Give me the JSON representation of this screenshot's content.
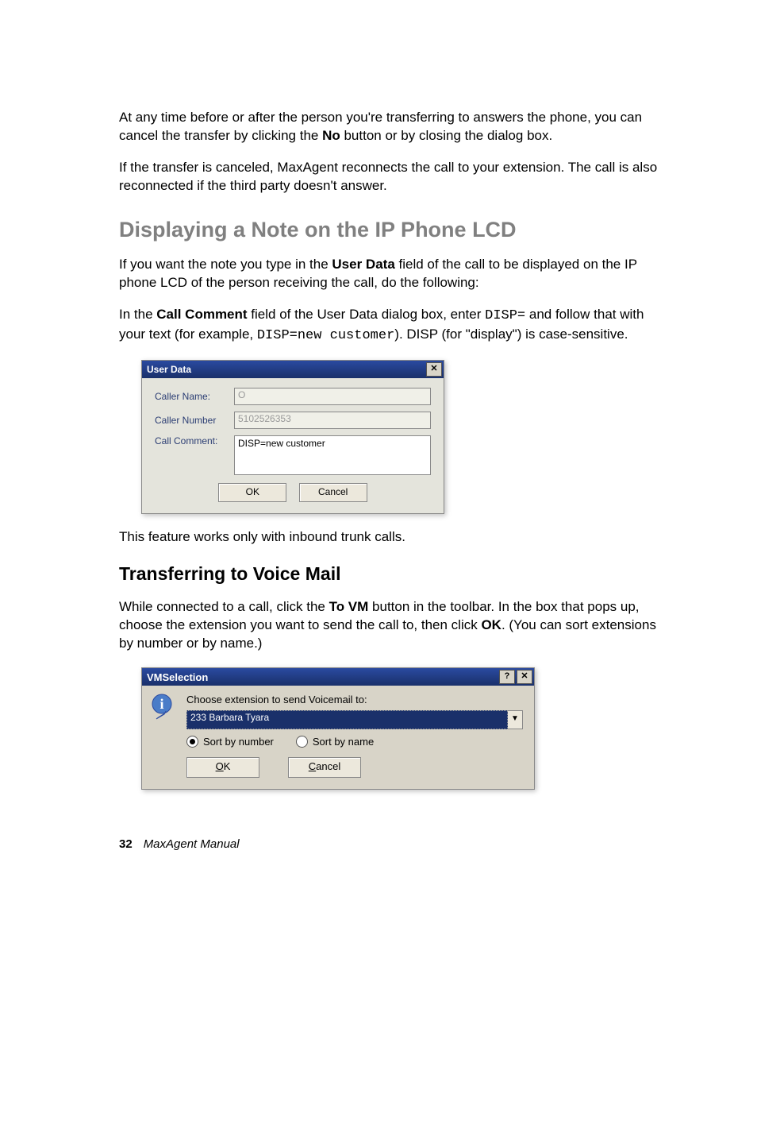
{
  "para1": "At any time before or after the person you're transferring to answers the phone, you can cancel the transfer by clicking the ",
  "para1_bold": "No",
  "para1_after": " button or by closing the dialog box.",
  "para2": "If the transfer is canceled, MaxAgent reconnects the call to your extension. The call is also reconnected if the third party doesn't answer.",
  "heading1": "Displaying a Note on the IP Phone LCD",
  "para3_a": "If you want the note you type in the ",
  "para3_b": "User Data",
  "para3_c": " field of the call to be displayed on the IP phone LCD of the person receiving the call, do the following:",
  "para4_a": "In the ",
  "para4_b": "Call Comment",
  "para4_c": " field of the User Data dialog box, enter ",
  "para4_code1": "DISP=",
  "para4_d": " and follow that with your text (for example, ",
  "para4_code2": "DISP=new customer",
  "para4_e": "). DISP (for \"display\") is case-sensitive.",
  "userdata_dialog": {
    "title": "User Data",
    "caller_name_label": "Caller Name:",
    "caller_name_value": "O",
    "caller_number_label": "Caller Number",
    "caller_number_value": "5102526353",
    "call_comment_label": "Call Comment:",
    "call_comment_value": "DISP=new customer",
    "ok": "OK",
    "cancel": "Cancel"
  },
  "para5": "This feature works only with inbound trunk calls.",
  "heading2": "Transferring to Voice Mail",
  "para6_a": "While connected to a call, click the ",
  "para6_b": "To VM",
  "para6_c": " button in the toolbar. In the box that pops up, choose the extension you want to send the call to, then click ",
  "para6_d": "OK",
  "para6_e": ". (You can sort extensions by number or by name.)",
  "vmselection_dialog": {
    "title": "VMSelection",
    "prompt": "Choose extension to send Voicemail to:",
    "selected": "233 Barbara Tyara",
    "sort_number": "Sort by number",
    "sort_name": "Sort by name",
    "ok_u": "O",
    "ok_rest": "K",
    "cancel_u": "C",
    "cancel_rest": "ancel"
  },
  "footer_page": "32",
  "footer_book": "MaxAgent Manual"
}
